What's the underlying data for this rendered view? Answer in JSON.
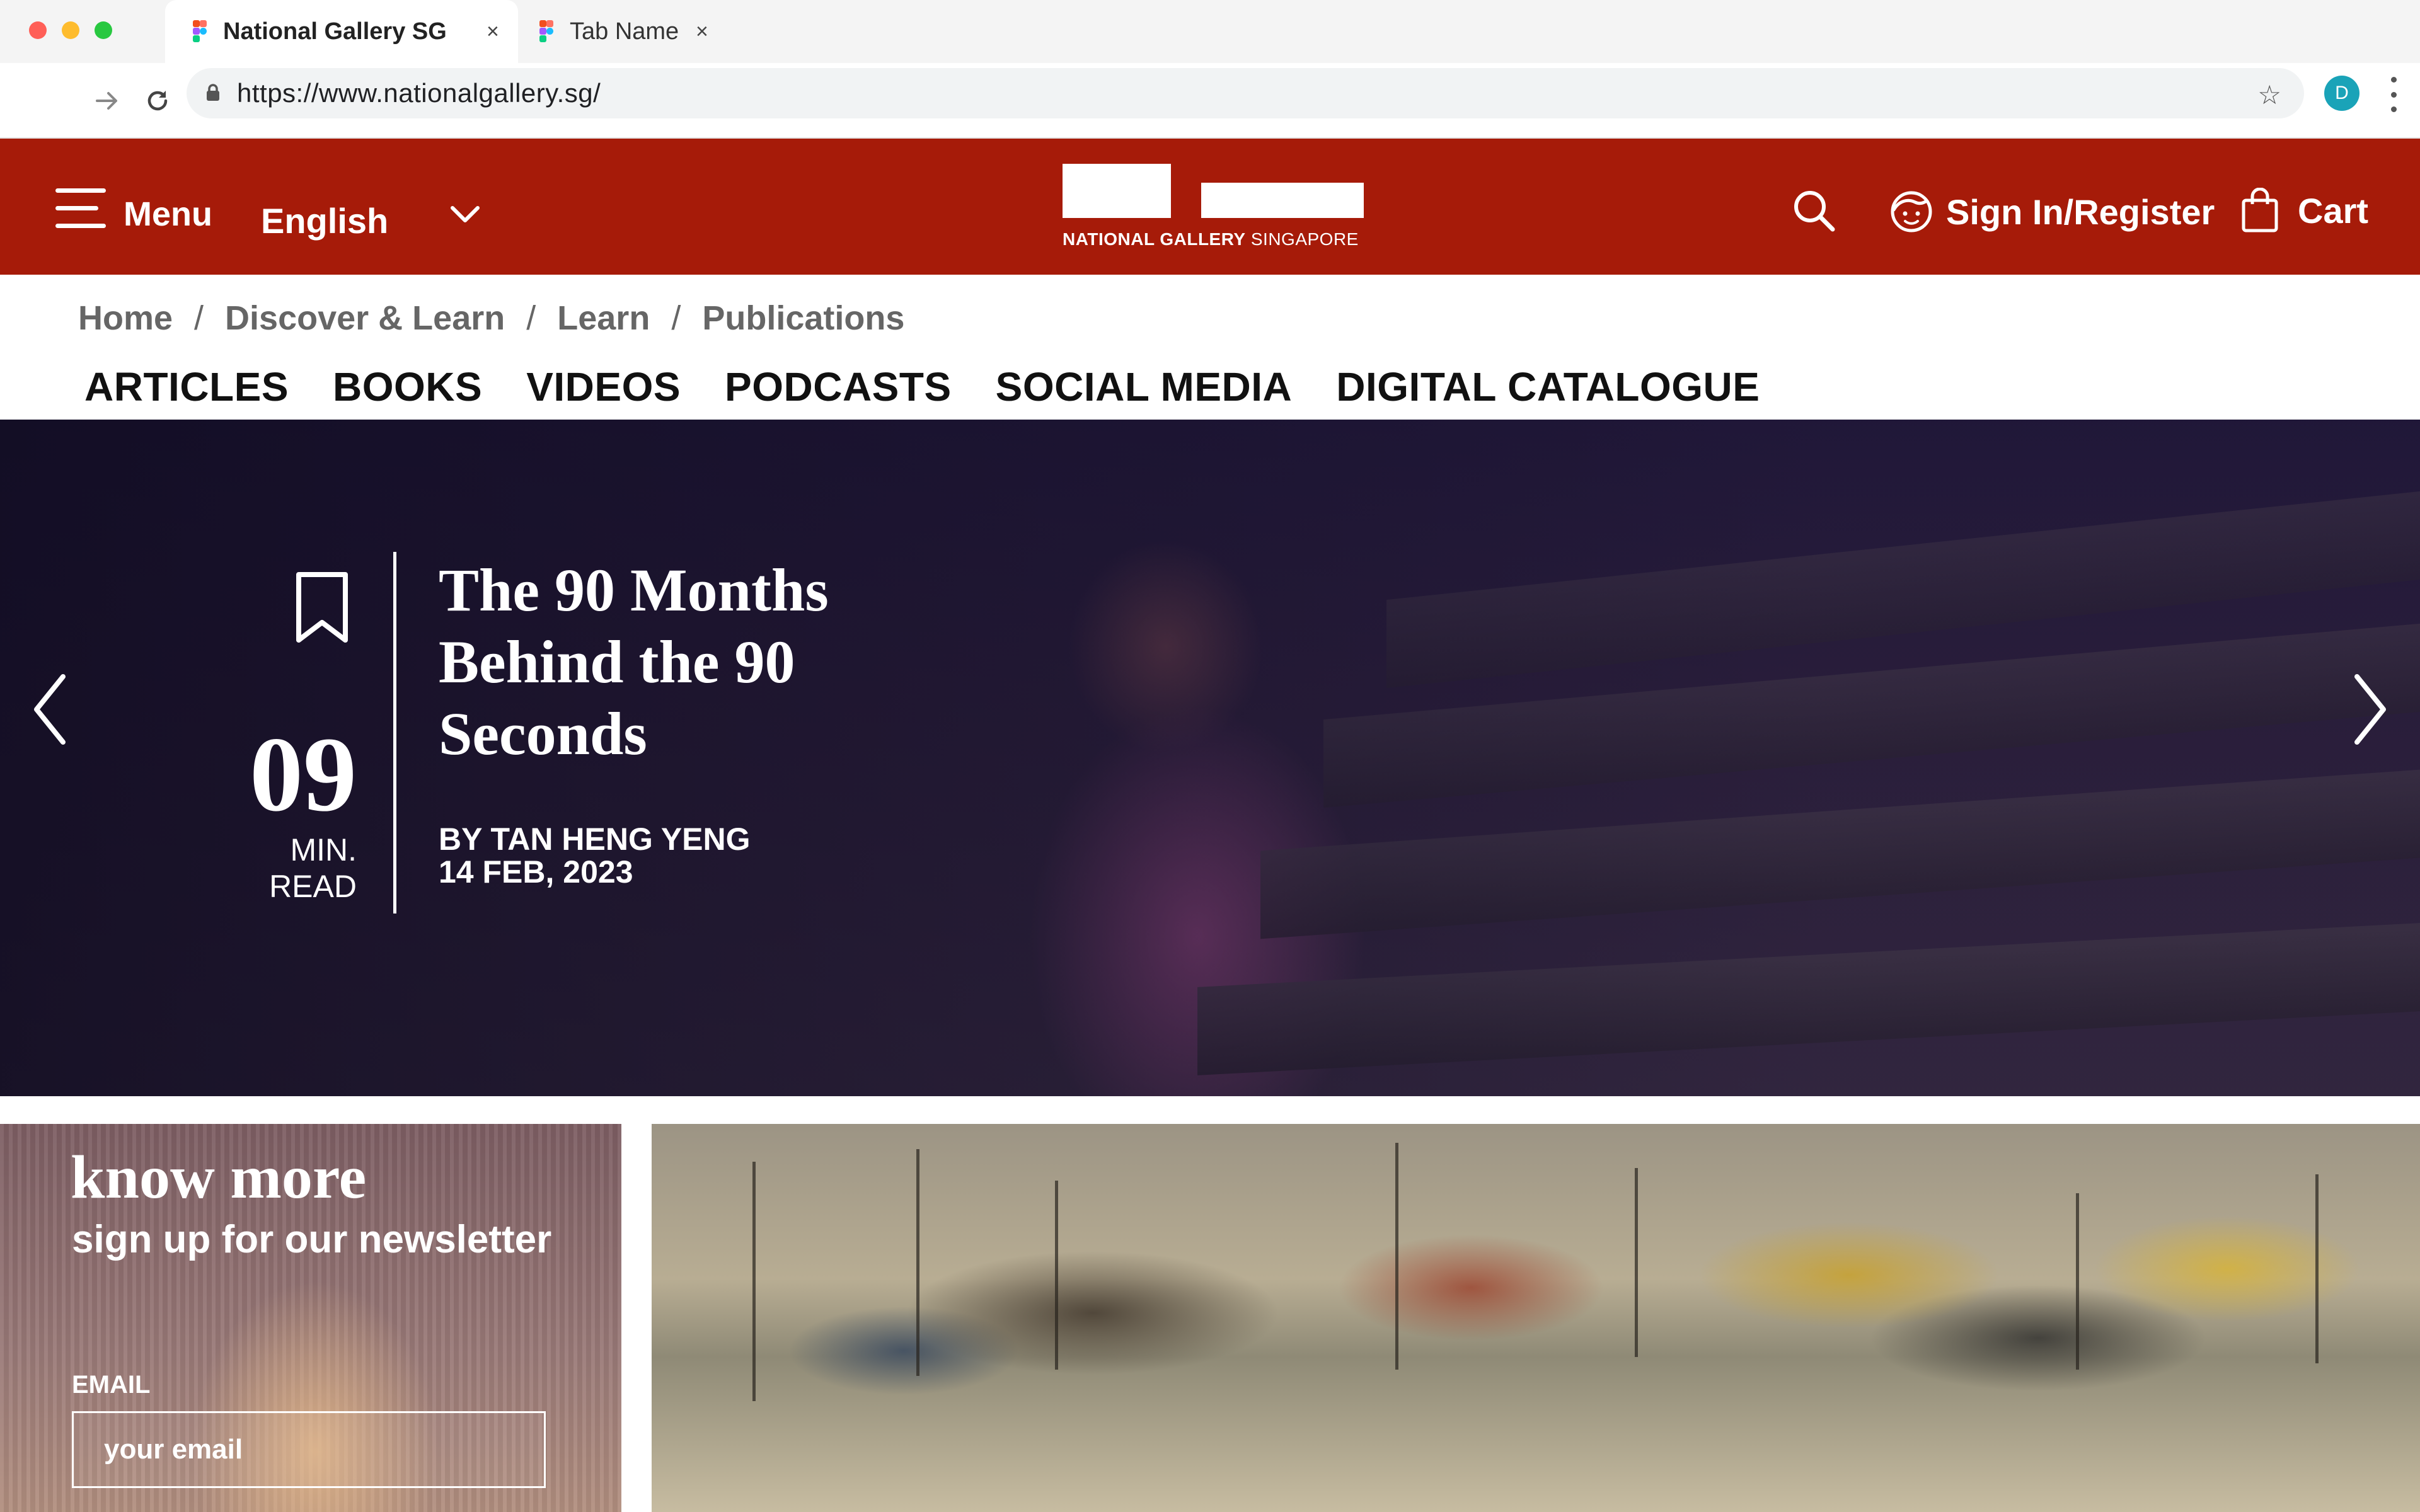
{
  "browser": {
    "tabs": [
      {
        "title": "National Gallery SG",
        "active": true
      },
      {
        "title": "Tab Name",
        "active": false
      }
    ],
    "close_glyph": "×",
    "url": "https://www.nationalgallery.sg/",
    "profile_initial": "D"
  },
  "header": {
    "menu_label": "Menu",
    "language": "English",
    "logo_text_bold": "NATIONAL GALLERY",
    "logo_text_light": " SINGAPORE",
    "sign_in_label": "Sign In/Register",
    "cart_label": "Cart",
    "brand_color": "#a61b09"
  },
  "breadcrumb": [
    "Home",
    "Discover & Learn",
    "Learn",
    "Publications"
  ],
  "breadcrumb_separator": "/",
  "category_nav": [
    "ARTICLES",
    "BOOKS",
    "VIDEOS",
    "PODCASTS",
    "SOCIAL MEDIA",
    "DIGITAL CATALOGUE"
  ],
  "hero": {
    "read_minutes": "09",
    "read_label": "MIN. READ",
    "title": "The 90 Months Behind the 90 Seconds",
    "author": "BY TAN HENG YENG",
    "date": "14 FEB, 2023"
  },
  "newsletter": {
    "title": "know more",
    "subtitle": "sign up for our newsletter",
    "email_label": "EMAIL",
    "email_placeholder": "your email"
  },
  "icons": {
    "menu": "hamburger-icon",
    "language_dropdown": "chevron-down-icon",
    "search": "search-icon",
    "user": "user-face-icon",
    "cart": "shopping-bag-icon",
    "bookmark": "bookmark-icon",
    "prev": "chevron-left-icon",
    "next": "chevron-right-icon"
  }
}
